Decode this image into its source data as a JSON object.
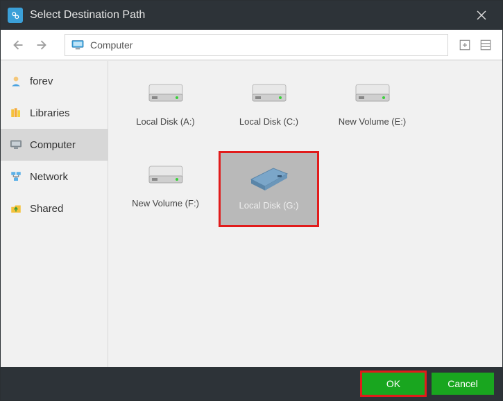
{
  "window": {
    "title": "Select Destination Path"
  },
  "toolbar": {
    "path": "Computer"
  },
  "sidebar": {
    "items": [
      {
        "id": "forev",
        "label": "forev",
        "icon": "user-icon"
      },
      {
        "id": "libraries",
        "label": "Libraries",
        "icon": "libraries-icon"
      },
      {
        "id": "computer",
        "label": "Computer",
        "icon": "computer-icon"
      },
      {
        "id": "network",
        "label": "Network",
        "icon": "network-icon"
      },
      {
        "id": "shared",
        "label": "Shared",
        "icon": "shared-icon"
      }
    ],
    "active": "computer"
  },
  "drives": [
    {
      "label": "Local Disk (A:)",
      "selected": false,
      "led": "green"
    },
    {
      "label": "Local Disk (C:)",
      "selected": false,
      "led": "green"
    },
    {
      "label": "New Volume (E:)",
      "selected": false,
      "led": "green"
    },
    {
      "label": "New Volume (F:)",
      "selected": false,
      "led": "green"
    },
    {
      "label": "Local Disk (G:)",
      "selected": true,
      "led": "blue"
    }
  ],
  "footer": {
    "ok": "OK",
    "cancel": "Cancel"
  },
  "colors": {
    "accent": "#19a61f",
    "highlight": "#e11b1b",
    "titlebar": "#2d3338"
  }
}
